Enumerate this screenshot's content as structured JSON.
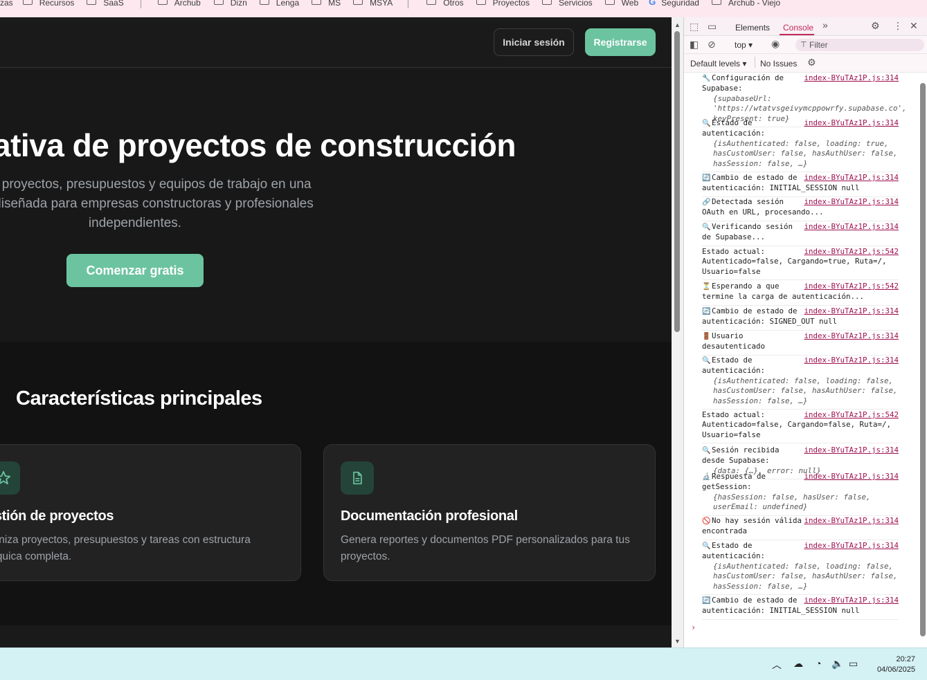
{
  "bookmarks": {
    "items": [
      {
        "label": "zas"
      },
      {
        "label": "Recursos"
      },
      {
        "label": "SaaS"
      },
      {
        "label": "Archub"
      },
      {
        "label": "Dizn"
      },
      {
        "label": "Lenga"
      },
      {
        "label": "MS"
      },
      {
        "label": "MSYA"
      },
      {
        "label": "Otros"
      },
      {
        "label": "Proyectos"
      },
      {
        "label": "Servicios"
      },
      {
        "label": "Web"
      },
      {
        "label": "Seguridad"
      },
      {
        "label": "Archub - Viejo"
      }
    ]
  },
  "header": {
    "login_label": "Iniciar sesión",
    "register_label": "Registrarse"
  },
  "hero": {
    "title": "ativa de proyectos de construcción",
    "subtitle_lines": [
      "tión de proyectos, presupuestos y equipos de trabajo en una",
      "derna diseñada para empresas constructoras y profesionales",
      "independientes."
    ],
    "cta_label": "Comenzar gratis"
  },
  "features": {
    "title": "Características principales",
    "cards": [
      {
        "icon": "star-icon",
        "title": "estión de proyectos",
        "desc": "ganiza proyectos, presupuestos y tareas con estructura árquica completa."
      },
      {
        "icon": "document-icon",
        "title": "Documentación profesional",
        "desc": "Genera reportes y documentos PDF personalizados para tus proyectos."
      }
    ]
  },
  "devtools": {
    "tabs": [
      "Elements",
      "Console"
    ],
    "active_tab": "Console",
    "context": "top",
    "filter_placeholder": "Filter",
    "levels_label": "Default levels",
    "issues_label": "No Issues",
    "accent": "#c3285a",
    "console": [
      {
        "icon": "wrench-icon",
        "text": "Configuración de Supabase:",
        "src": "index-BYuTAz1P.js:314",
        "detail": "{supabaseUrl: 'https://wtatvsgeivymcppowrfy.supabase.co', keyPresent: true}"
      },
      {
        "icon": "search-icon",
        "text": "Estado de autenticación:",
        "src": "index-BYuTAz1P.js:314",
        "detail": "{isAuthenticated: false, loading: true, hasCustomUser: false, hasAuthUser: false, hasSession: false, …}"
      },
      {
        "icon": "refresh-icon",
        "text": "Cambio de estado de autenticación: INITIAL_SESSION null",
        "src": "index-BYuTAz1P.js:314",
        "detail": ""
      },
      {
        "icon": "link-icon",
        "text": "Detectada sesión OAuth en URL, procesando...",
        "src": "index-BYuTAz1P.js:314",
        "detail": ""
      },
      {
        "icon": "search-icon",
        "text": "Verificando sesión de Supabase...",
        "src": "index-BYuTAz1P.js:314",
        "detail": ""
      },
      {
        "icon": "",
        "text": "Estado actual: Autenticado=false, Cargando=true, Ruta=/, Usuario=false",
        "src": "index-BYuTAz1P.js:542",
        "detail": ""
      },
      {
        "icon": "hourglass-icon",
        "text": "Esperando a que termine la carga de autenticación...",
        "src": "index-BYuTAz1P.js:542",
        "detail": ""
      },
      {
        "icon": "refresh-icon",
        "text": "Cambio de estado de autenticación: SIGNED_OUT null",
        "src": "index-BYuTAz1P.js:314",
        "detail": ""
      },
      {
        "icon": "door-icon",
        "text": "Usuario desautenticado",
        "src": "index-BYuTAz1P.js:314",
        "detail": ""
      },
      {
        "icon": "search-icon",
        "text": "Estado de autenticación:",
        "src": "index-BYuTAz1P.js:314",
        "detail": "{isAuthenticated: false, loading: false, hasCustomUser: false, hasAuthUser: false, hasSession: false, …}"
      },
      {
        "icon": "",
        "text": "Estado actual: Autenticado=false, Cargando=false, Ruta=/, Usuario=false",
        "src": "index-BYuTAz1P.js:542",
        "detail": ""
      },
      {
        "icon": "search-icon",
        "text": "Sesión recibida desde Supabase:",
        "src": "index-BYuTAz1P.js:314",
        "detail": "{data: {…}, error: null}"
      },
      {
        "icon": "microscope-icon",
        "text": "Respuesta de getSession:",
        "src": "index-BYuTAz1P.js:314",
        "detail": "{hasSession: false, hasUser: false, userEmail: undefined}"
      },
      {
        "icon": "no-entry-icon",
        "text": "No hay sesión válida encontrada",
        "src": "index-BYuTAz1P.js:314",
        "detail": ""
      },
      {
        "icon": "search-icon",
        "text": "Estado de autenticación:",
        "src": "index-BYuTAz1P.js:314",
        "detail": "{isAuthenticated: false, loading: false, hasCustomUser: false, hasAuthUser: false, hasSession: false, …}"
      },
      {
        "icon": "refresh-icon",
        "text": "Cambio de estado de autenticación: INITIAL_SESSION null",
        "src": "index-BYuTAz1P.js:314",
        "detail": ""
      }
    ]
  },
  "taskbar": {
    "time": "20:27",
    "date": "04/06/2025"
  },
  "colors": {
    "accent_green": "#6cc3a0",
    "background": "#1a1a1a"
  }
}
